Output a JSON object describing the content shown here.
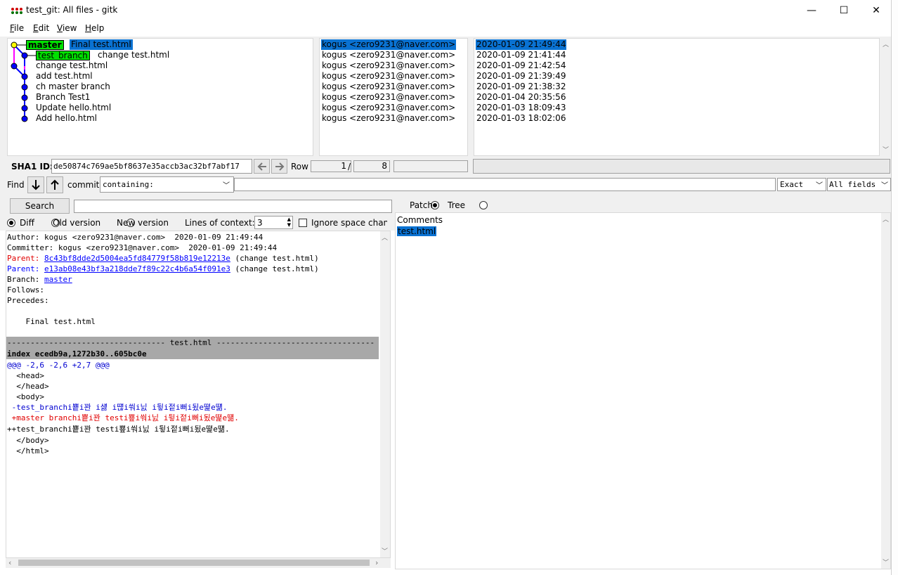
{
  "window": {
    "title": "test_git: All files - gitk",
    "minimize": "—",
    "maximize": "☐",
    "close": "✕"
  },
  "menu": {
    "file_key": "F",
    "file_rest": "ile",
    "edit_key": "E",
    "edit_rest": "dit",
    "view_key": "V",
    "view_rest": "iew",
    "help_key": "H",
    "help_rest": "elp"
  },
  "commits": [
    {
      "branch": "master",
      "message": "Final test.html",
      "author": "kogus <zero9231@naver.com>",
      "date": "2020-01-09 21:49:44"
    },
    {
      "branch": "test_branch",
      "message": "change test.html",
      "author": "kogus <zero9231@naver.com>",
      "date": "2020-01-09 21:41:44"
    },
    {
      "branch": "",
      "message": "change test.html",
      "author": "kogus <zero9231@naver.com>",
      "date": "2020-01-09 21:42:54"
    },
    {
      "branch": "",
      "message": "add test.html",
      "author": "kogus <zero9231@naver.com>",
      "date": "2020-01-09 21:39:49"
    },
    {
      "branch": "",
      "message": "ch master branch",
      "author": "kogus <zero9231@naver.com>",
      "date": "2020-01-09 21:38:32"
    },
    {
      "branch": "",
      "message": "Branch Test1",
      "author": "kogus <zero9231@naver.com>",
      "date": "2020-01-04 20:35:56"
    },
    {
      "branch": "",
      "message": "Update hello.html",
      "author": "kogus <zero9231@naver.com>",
      "date": "2020-01-03 18:09:43"
    },
    {
      "branch": "",
      "message": "Add hello.html",
      "author": "kogus <zero9231@naver.com>",
      "date": "2020-01-03 18:02:06"
    }
  ],
  "sha_bar": {
    "label": "SHA1 ID:",
    "value": "de50874c769ae5bf8637e35accb3ac32bf7abf17",
    "row_label": "Row",
    "row_current": "1",
    "row_sep": "/",
    "row_total": "8"
  },
  "find_bar": {
    "find_label": "Find",
    "commit_label": "commit",
    "mode": "containing:",
    "match": "Exact",
    "fields": "All fields"
  },
  "search": {
    "button": "Search"
  },
  "diff_options": {
    "diff": "Diff",
    "old_version": "Old version",
    "new_version": "New version",
    "context_label": "Lines of context:",
    "context_value": "3",
    "ignore_space": "Ignore space chang"
  },
  "right_pane": {
    "patch": "Patch",
    "tree": "Tree",
    "files": [
      "Comments",
      "test.html"
    ]
  },
  "details": {
    "author": "Author: kogus <zero9231@naver.com>  2020-01-09 21:49:44",
    "committer": "Committer: kogus <zero9231@naver.com>  2020-01-09 21:49:44",
    "parent1_label": "Parent: ",
    "parent1_sha": "8c43bf8dde2d5004ea5fd84779f58b819e12213e",
    "parent1_msg": " (change test.html)",
    "parent2_label": "Parent: ",
    "parent2_sha": "e13ab08e43bf3a218dde7f89c22c4b6a54f091e3",
    "parent2_msg": " (change test.html)",
    "branch_label": "Branch: ",
    "branch_value": "master",
    "follows": "Follows:",
    "precedes": "Precedes:",
    "message": "    Final test.html"
  },
  "diff": {
    "file_header": "---------------------------------- test.html ----------------------------------",
    "index_line": "index ecedb9a,1272b30..605bc0e",
    "hunk": "@@@ -2,6 -2,6 +2,7 @@@",
    "lines": [
      {
        "text": "  <head>",
        "kind": "ctx"
      },
      {
        "text": "  </head>",
        "kind": "ctx"
      },
      {
        "text": "  <body>",
        "kind": "ctx"
      },
      {
        "text": " -test_branchi뿉i꽌 i섏 i떊i쒀i닔 i뒿i젙i뻐i됬e뗥e떎.",
        "kind": "minus"
      },
      {
        "text": " +master branchi뿉i꽌 testi뿊i쒀i닔 i뒿i젙i뻐i됬e뗥e떎.",
        "kind": "plus"
      },
      {
        "text": "++test_branchi뿉i꽌 testi뿊i쒀i닔 i뒿i젙i뻐i됬e뗥e떎.",
        "kind": "merged"
      },
      {
        "text": "  </body>",
        "kind": "ctx"
      },
      {
        "text": "  </html>",
        "kind": "ctx"
      }
    ]
  },
  "colors": {
    "selection": "#0a72d2",
    "branch_tag": "#00e000",
    "link": "#0000ff",
    "removed": "#0000d0",
    "added": "#e00000",
    "header_bg": "#a8a8a8"
  }
}
